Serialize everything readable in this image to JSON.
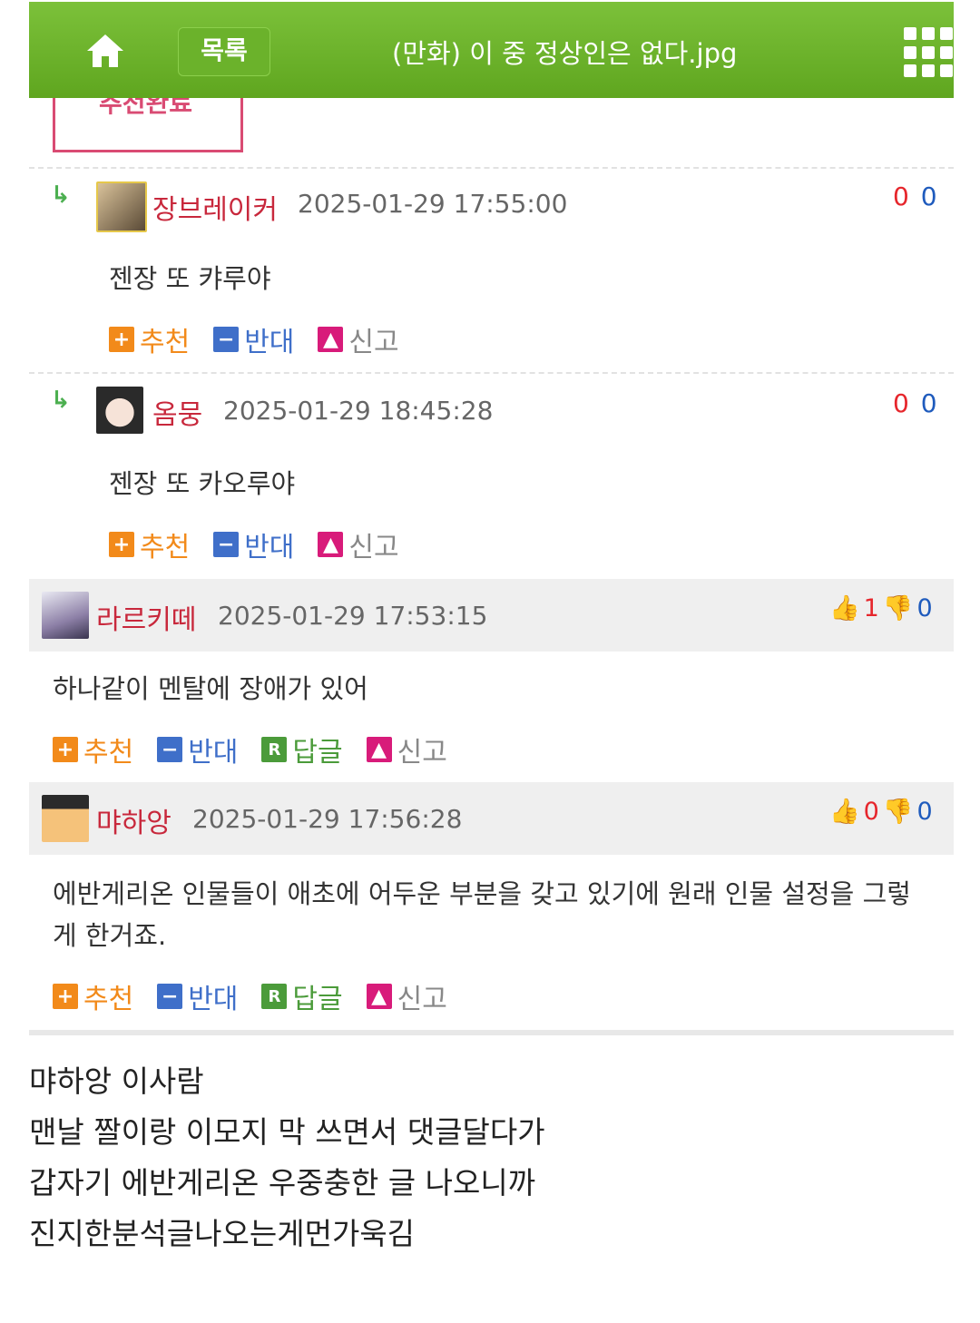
{
  "header": {
    "list_label": "목록",
    "title": "(만화) 이 중 정상인은 없다.jpg",
    "home_icon": "home-icon",
    "menu_icon": "grid-menu-icon"
  },
  "recommend_done": "추천완료",
  "actions": {
    "recommend": "추천",
    "oppose": "반대",
    "reply": "답글",
    "report": "신고"
  },
  "replies": [
    {
      "nick": "장브레이커",
      "date": "2025-01-29 17:55:00",
      "up": "0",
      "down": "0",
      "text": "젠장 또 캬루야"
    },
    {
      "nick": "옴뭉",
      "date": "2025-01-29 18:45:28",
      "up": "0",
      "down": "0",
      "text": "젠장 또 카오루야"
    }
  ],
  "comments": [
    {
      "nick": "라르키떼",
      "date": "2025-01-29 17:53:15",
      "up": "1",
      "down": "0",
      "text_lines": [
        "하나같이 멘탈에 장애가 있어"
      ]
    },
    {
      "nick": "먀하앙",
      "date": "2025-01-29 17:56:28",
      "up": "0",
      "down": "0",
      "text_lines": [
        "에반게리온 인물들이 애초에 어두운 부분을 갖고 있기에 원래 인물 설정을 그렇",
        "게 한거죠."
      ]
    }
  ],
  "caption": [
    "먀하앙 이사람",
    "맨날 짤이랑 이모지 막 쓰면서 댓글달다가",
    "갑자기 에반게리온 우중충한 글 나오니까",
    "진지한분석글나오는게먼가욱김"
  ],
  "colors": {
    "topbar": "#6bb22b",
    "nick": "#c8283c",
    "accent_orange": "#f28a1a",
    "accent_blue": "#3f6fc9"
  }
}
